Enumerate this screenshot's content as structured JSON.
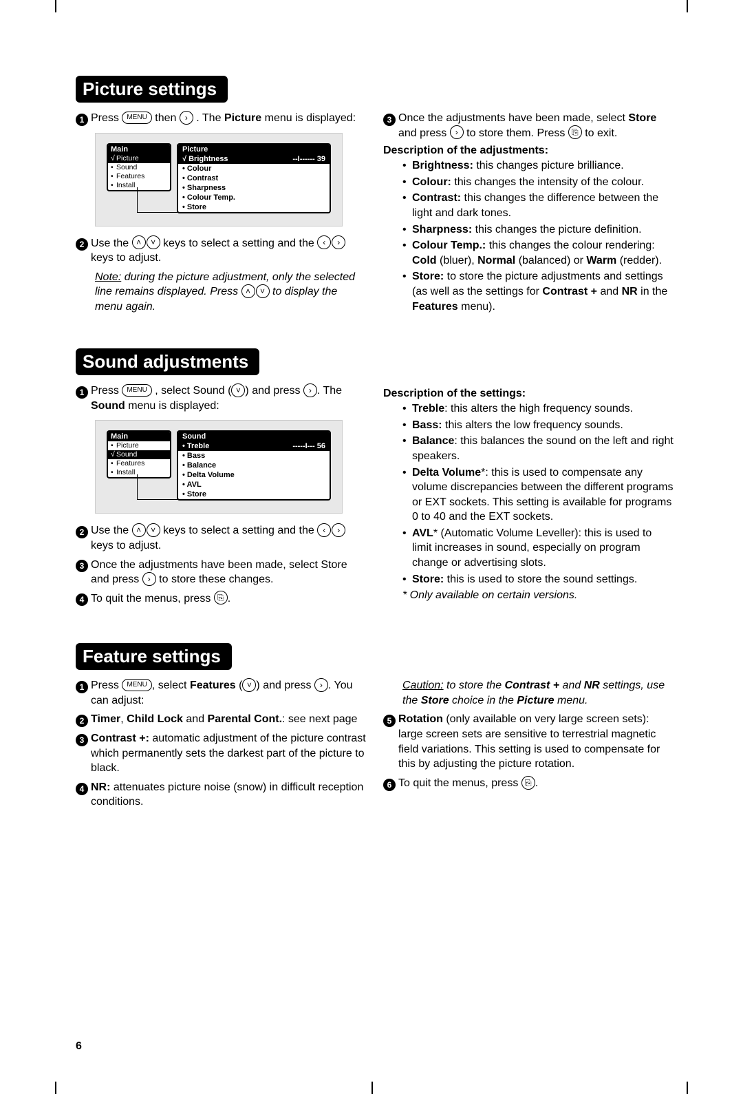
{
  "page_number": "6",
  "sections": {
    "picture": {
      "heading": "Picture settings",
      "steps": {
        "s1a": "Press ",
        "s1_menu": "MENU",
        "s1b": " then ",
        "s1c": ". The ",
        "s1d": " menu is displayed:",
        "s1_bold": "Picture",
        "s2a": "Use the ",
        "s2b": " keys to select a setting and the ",
        "s2c": " keys to adjust.",
        "note_u": "Note:",
        "note1": " during the picture adjustment, only the selected line remains displayed. Press ",
        "note2": " to display the menu again.",
        "s3a": "Once the adjustments have been made, select ",
        "s3_store": "Store",
        "s3b": " and press ",
        "s3c": " to store them. Press ",
        "s3d": " to exit."
      },
      "desc_heading": "Description of the adjustments:",
      "desc": {
        "brightness_b": "Brightness:",
        "brightness": " this changes picture brilliance.",
        "colour_b": "Colour:",
        "colour": " this changes the intensity of the colour.",
        "contrast_b": "Contrast:",
        "contrast": " this changes the difference between the light and dark tones.",
        "sharpness_b": "Sharpness:",
        "sharpness": " this changes the picture definition.",
        "colourtemp_b": "Colour Temp.:",
        "colourtemp1": " this changes the colour rendering: ",
        "ct_cold": "Cold",
        "ct_cold2": " (bluer), ",
        "ct_normal": "Normal",
        "ct_normal2": " (balanced) or ",
        "ct_warm": "Warm",
        "ct_warm2": " (redder).",
        "store_b": "Store:",
        "store1": " to store the picture adjustments and settings (as well as the settings for ",
        "store_cp": "Contrast +",
        "store2": " and ",
        "store_nr": "NR",
        "store3": " in the ",
        "store_feat": "Features",
        "store4": " menu)."
      },
      "osd": {
        "main_title": "Main",
        "main_items": [
          "Picture",
          "Sound",
          "Features",
          "Install"
        ],
        "main_selected_index": 0,
        "sub_title": "Picture",
        "sub_selected": "Brightness",
        "sub_bar": "--I------",
        "sub_value": "39",
        "sub_items": [
          "Colour",
          "Contrast",
          "Sharpness",
          "Colour Temp.",
          "Store"
        ]
      }
    },
    "sound": {
      "heading": "Sound adjustments",
      "steps": {
        "s1a": "Press ",
        "s1_menu": "MENU",
        "s1b": ", select Sound (",
        "s1c": ") and press ",
        "s1d": ". The ",
        "s1_bold": "Sound",
        "s1e": " menu is displayed:",
        "s2a": "Use the ",
        "s2b": " keys to select a setting and the ",
        "s2c": " keys to adjust.",
        "s3a": "Once the adjustments have been made, select Store and press ",
        "s3b": " to store these changes.",
        "s4a": "To quit the menus, press ",
        "s4b": "."
      },
      "desc_heading": "Description of the settings:",
      "desc": {
        "treble_b": "Treble",
        "treble": ": this alters the high frequency sounds.",
        "bass_b": "Bass:",
        "bass": " this alters the low frequency sounds.",
        "balance_b": "Balance",
        "balance": ": this balances the sound on the left and right speakers.",
        "delta_b": "Delta Volume",
        "delta_star": "*",
        "delta": ": this is used to compensate any volume discrepancies between the different programs or EXT sockets. This setting is available for programs 0 to 40 and the EXT sockets.",
        "avl_b": "AVL",
        "avl_star": "*",
        "avl1": " (Automatic Volume Leveller): this is used to limit increases in sound, especially on program change or advertising slots.",
        "store_b": "Store:",
        "store": " this is used to store the sound settings.",
        "footnote": "* Only available on certain versions."
      },
      "osd": {
        "main_title": "Main",
        "main_items": [
          "Picture",
          "Sound",
          "Features",
          "Install"
        ],
        "main_selected_index": 1,
        "sub_title": "Sound",
        "sub_selected": "Treble",
        "sub_bar": "-----I---",
        "sub_value": "56",
        "sub_items": [
          "Bass",
          "Balance",
          "Delta Volume",
          "AVL",
          "Store"
        ]
      }
    },
    "feature": {
      "heading": "Feature settings",
      "steps": {
        "s1a": "Press ",
        "s1_menu": "MENU",
        "s1b": ", select ",
        "s1_feat": "Features",
        "s1c": " (",
        "s1d": ") and press ",
        "s1e": ". You can adjust:",
        "s2_timer": "Timer",
        "s2_sep1": ", ",
        "s2_cl": "Child Lock",
        "s2_sep2": " and ",
        "s2_pc": "Parental Cont.",
        "s2_tail": ": see next page",
        "s3_b": "Contrast +:",
        "s3": " automatic adjustment of the picture contrast which permanently sets the darkest part of the picture to black.",
        "s4_b": "NR:",
        "s4": " attenuates picture noise (snow) in difficult reception conditions.",
        "caution_u": "Caution:",
        "caution1": " to store the ",
        "caution_cp": "Contrast +",
        "caution2": " and ",
        "caution_nr": "NR",
        "caution3": " settings, use the ",
        "caution_store": "Store",
        "caution4": " choice in the ",
        "caution_pic": "Picture",
        "caution5": " menu.",
        "s5_b": "Rotation",
        "s5": " (only available on very large screen sets): large screen sets are sensitive to terrestrial magnetic field variations. This setting is used to compensate for this by adjusting the picture rotation.",
        "s6a": "To quit the menus, press ",
        "s6b": "."
      }
    }
  },
  "glyphs": {
    "right": "›",
    "left": "‹",
    "up": "˄",
    "down": "˅",
    "exit": "⎘"
  }
}
